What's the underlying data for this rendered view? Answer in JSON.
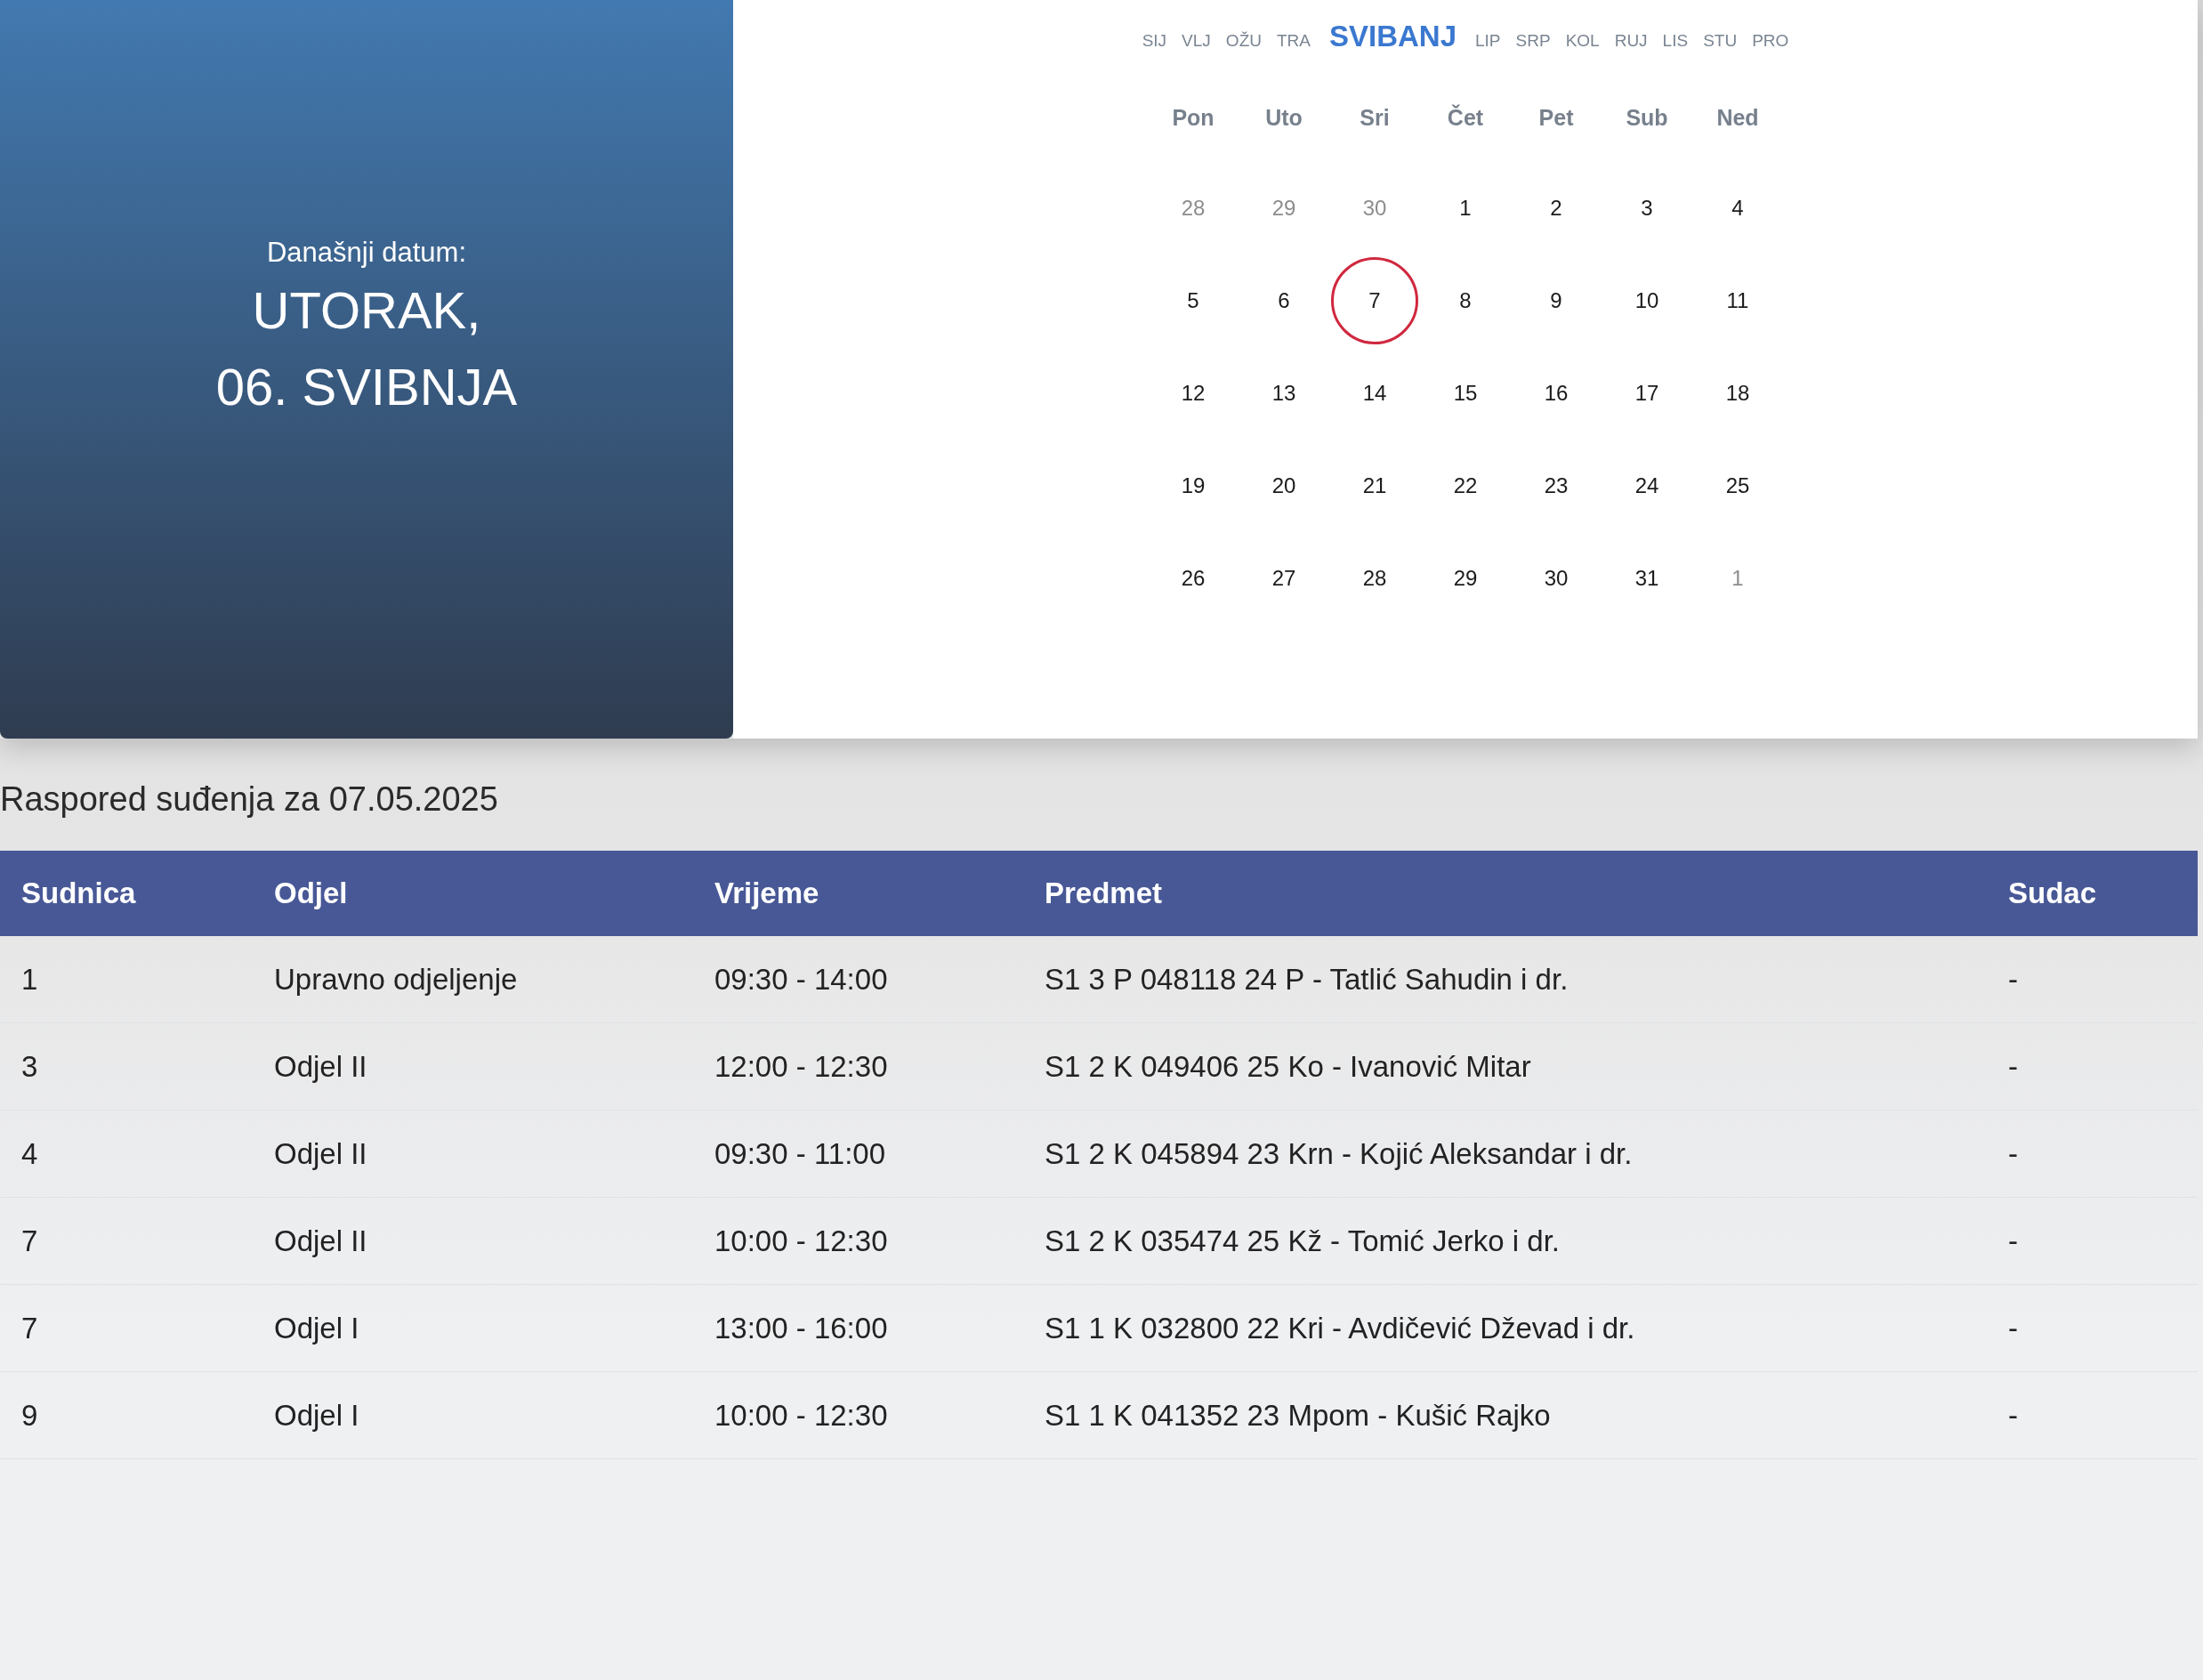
{
  "today_panel": {
    "label": "Današnji datum:",
    "weekday": "UTORAK,",
    "date": "06. SVIBNJA"
  },
  "calendar": {
    "months": [
      {
        "label": "SIJ",
        "selected": false
      },
      {
        "label": "VLJ",
        "selected": false
      },
      {
        "label": "OŽU",
        "selected": false
      },
      {
        "label": "TRA",
        "selected": false
      },
      {
        "label": "SVIBANJ",
        "selected": true
      },
      {
        "label": "LIP",
        "selected": false
      },
      {
        "label": "SRP",
        "selected": false
      },
      {
        "label": "KOL",
        "selected": false
      },
      {
        "label": "RUJ",
        "selected": false
      },
      {
        "label": "LIS",
        "selected": false
      },
      {
        "label": "STU",
        "selected": false
      },
      {
        "label": "PRO",
        "selected": false
      }
    ],
    "weekdays": [
      "Pon",
      "Uto",
      "Sri",
      "Čet",
      "Pet",
      "Sub",
      "Ned"
    ],
    "days": [
      {
        "label": "28",
        "muted": true,
        "selected": false
      },
      {
        "label": "29",
        "muted": true,
        "selected": false
      },
      {
        "label": "30",
        "muted": true,
        "selected": false
      },
      {
        "label": "1",
        "muted": false,
        "selected": false
      },
      {
        "label": "2",
        "muted": false,
        "selected": false
      },
      {
        "label": "3",
        "muted": false,
        "selected": false
      },
      {
        "label": "4",
        "muted": false,
        "selected": false
      },
      {
        "label": "5",
        "muted": false,
        "selected": false
      },
      {
        "label": "6",
        "muted": false,
        "selected": false
      },
      {
        "label": "7",
        "muted": false,
        "selected": true
      },
      {
        "label": "8",
        "muted": false,
        "selected": false
      },
      {
        "label": "9",
        "muted": false,
        "selected": false
      },
      {
        "label": "10",
        "muted": false,
        "selected": false
      },
      {
        "label": "11",
        "muted": false,
        "selected": false
      },
      {
        "label": "12",
        "muted": false,
        "selected": false
      },
      {
        "label": "13",
        "muted": false,
        "selected": false
      },
      {
        "label": "14",
        "muted": false,
        "selected": false
      },
      {
        "label": "15",
        "muted": false,
        "selected": false
      },
      {
        "label": "16",
        "muted": false,
        "selected": false
      },
      {
        "label": "17",
        "muted": false,
        "selected": false
      },
      {
        "label": "18",
        "muted": false,
        "selected": false
      },
      {
        "label": "19",
        "muted": false,
        "selected": false
      },
      {
        "label": "20",
        "muted": false,
        "selected": false
      },
      {
        "label": "21",
        "muted": false,
        "selected": false
      },
      {
        "label": "22",
        "muted": false,
        "selected": false
      },
      {
        "label": "23",
        "muted": false,
        "selected": false
      },
      {
        "label": "24",
        "muted": false,
        "selected": false
      },
      {
        "label": "25",
        "muted": false,
        "selected": false
      },
      {
        "label": "26",
        "muted": false,
        "selected": false
      },
      {
        "label": "27",
        "muted": false,
        "selected": false
      },
      {
        "label": "28",
        "muted": false,
        "selected": false
      },
      {
        "label": "29",
        "muted": false,
        "selected": false
      },
      {
        "label": "30",
        "muted": false,
        "selected": false
      },
      {
        "label": "31",
        "muted": false,
        "selected": false
      },
      {
        "label": "1",
        "muted": true,
        "selected": false
      }
    ]
  },
  "schedule": {
    "title": "Raspored suđenja za 07.05.2025",
    "columns": [
      "Sudnica",
      "Odjel",
      "Vrijeme",
      "Predmet",
      "Sudac"
    ],
    "rows": [
      [
        "1",
        "Upravno odjeljenje",
        "09:30 - 14:00",
        "S1 3 P 048118 24 P - Tatlić Sahudin i dr.",
        "-"
      ],
      [
        "3",
        "Odjel II",
        "12:00 - 12:30",
        "S1 2 K 049406 25 Ko - Ivanović Mitar",
        "-"
      ],
      [
        "4",
        "Odjel II",
        "09:30 - 11:00",
        "S1 2 K 045894 23 Krn - Kojić Aleksandar i dr.",
        "-"
      ],
      [
        "7",
        "Odjel II",
        "10:00 - 12:30",
        "S1 2 K 035474 25 Kž - Tomić Jerko i dr.",
        "-"
      ],
      [
        "7",
        "Odjel I",
        "13:00 - 16:00",
        "S1 1 K 032800 22 Kri - Avdičević Dževad i dr.",
        "-"
      ],
      [
        "9",
        "Odjel I",
        "10:00 - 12:30",
        "S1 1 K 041352 23 Mpom - Kušić Rajko",
        "-"
      ]
    ]
  }
}
